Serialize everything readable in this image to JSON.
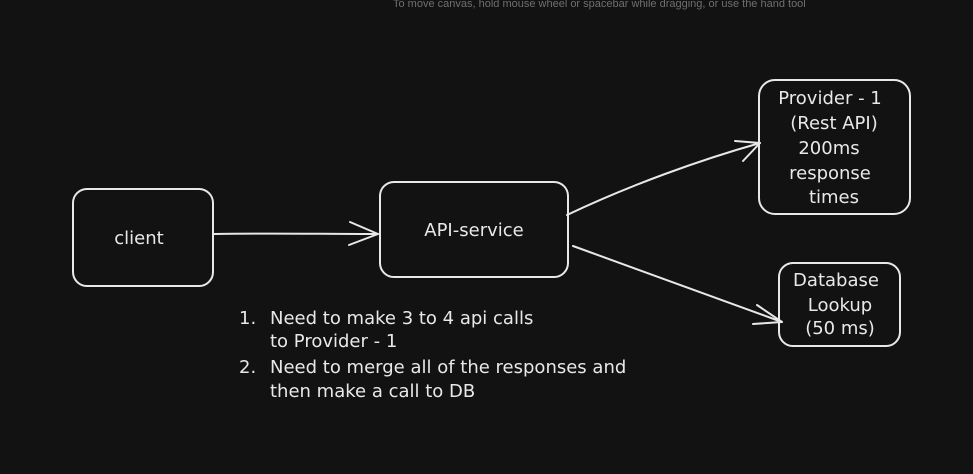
{
  "canvas_hint": "To move canvas, hold mouse wheel or spacebar while dragging, or use the hand tool",
  "nodes": {
    "client": {
      "label": "client"
    },
    "api_service": {
      "label": "API-service"
    },
    "provider": {
      "lines": [
        "Provider - 1",
        "(Rest API)",
        "200ms",
        "response",
        "times"
      ]
    },
    "database": {
      "lines": [
        "Database",
        "Lookup",
        "(50 ms)"
      ]
    }
  },
  "notes": [
    {
      "number": "1.",
      "lines": [
        "Need to make 3 to 4 api calls",
        "to Provider - 1"
      ]
    },
    {
      "number": "2.",
      "lines": [
        "Need to merge all of the responses and",
        "then make a call to DB"
      ]
    }
  ],
  "colors": {
    "background": "#121212",
    "stroke": "#e8e8e8",
    "hint": "#6f6f6f"
  }
}
